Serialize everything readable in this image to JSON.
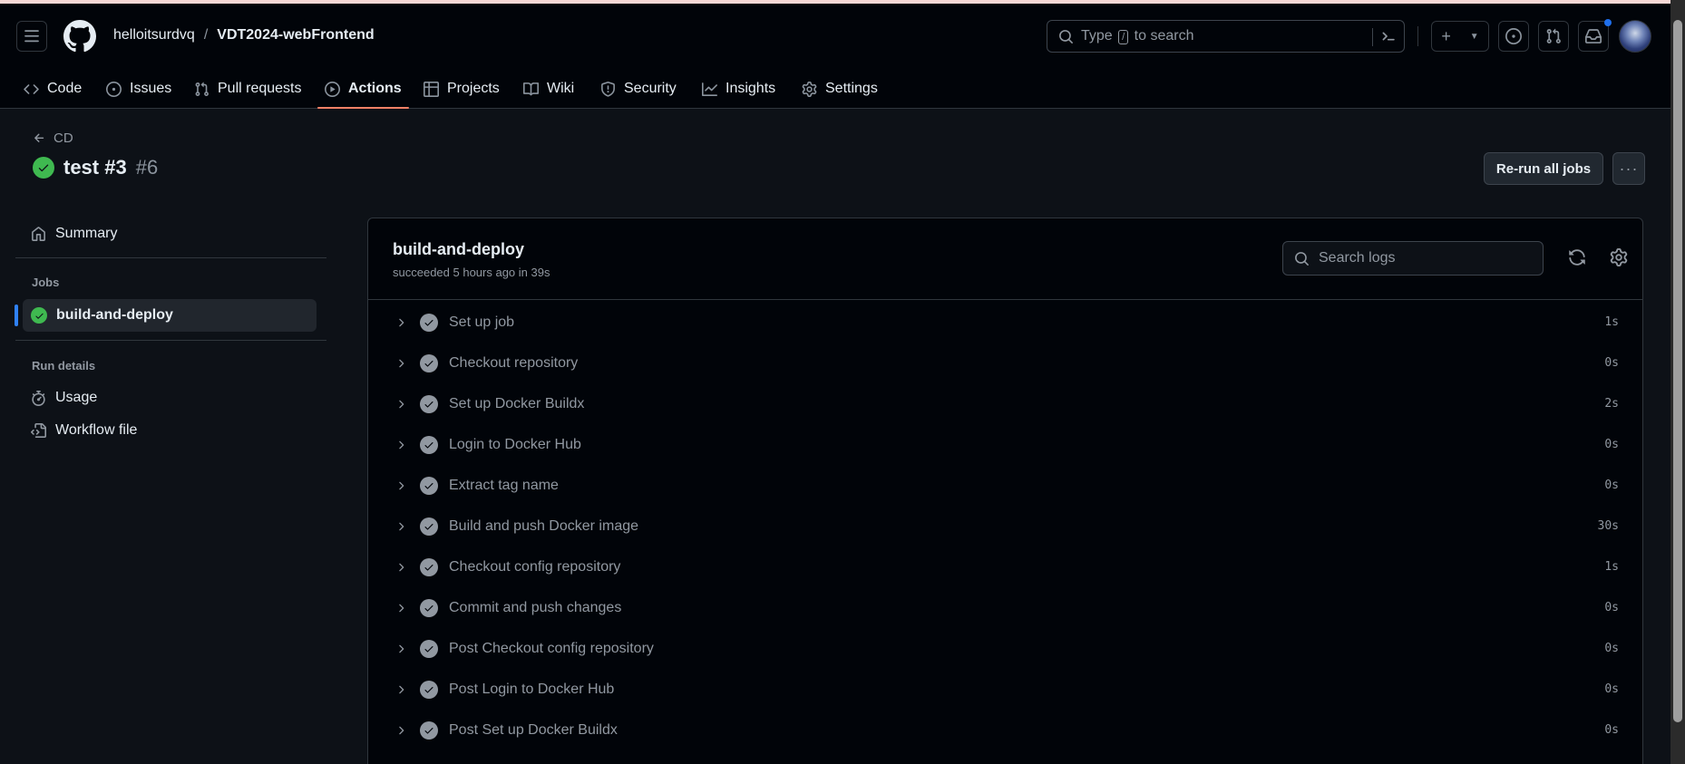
{
  "header": {
    "owner": "helloitsurdvq",
    "separator": "/",
    "repo": "VDT2024-webFrontend",
    "search_prefix": "Type",
    "search_key": "/",
    "search_suffix": "to search"
  },
  "nav": {
    "tabs": [
      {
        "label": "Code",
        "icon": "code-icon"
      },
      {
        "label": "Issues",
        "icon": "issue-icon"
      },
      {
        "label": "Pull requests",
        "icon": "pull-request-icon"
      },
      {
        "label": "Actions",
        "icon": "play-icon",
        "active": true
      },
      {
        "label": "Projects",
        "icon": "table-icon"
      },
      {
        "label": "Wiki",
        "icon": "book-icon"
      },
      {
        "label": "Security",
        "icon": "shield-icon"
      },
      {
        "label": "Insights",
        "icon": "graph-icon"
      },
      {
        "label": "Settings",
        "icon": "gear-icon"
      }
    ]
  },
  "run": {
    "back_label": "CD",
    "title": "test #3",
    "number": "#6",
    "rerun_label": "Re-run all jobs",
    "more_label": "···"
  },
  "sidebar": {
    "summary_label": "Summary",
    "jobs_heading": "Jobs",
    "job_label": "build-and-deploy",
    "run_details_heading": "Run details",
    "usage_label": "Usage",
    "workflow_file_label": "Workflow file"
  },
  "job": {
    "name": "build-and-deploy",
    "meta": "succeeded 5 hours ago in 39s",
    "search_placeholder": "Search logs"
  },
  "steps": [
    {
      "label": "Set up job",
      "duration": "1s"
    },
    {
      "label": "Checkout repository",
      "duration": "0s"
    },
    {
      "label": "Set up Docker Buildx",
      "duration": "2s"
    },
    {
      "label": "Login to Docker Hub",
      "duration": "0s"
    },
    {
      "label": "Extract tag name",
      "duration": "0s"
    },
    {
      "label": "Build and push Docker image",
      "duration": "30s"
    },
    {
      "label": "Checkout config repository",
      "duration": "1s"
    },
    {
      "label": "Commit and push changes",
      "duration": "0s"
    },
    {
      "label": "Post Checkout config repository",
      "duration": "0s"
    },
    {
      "label": "Post Login to Docker Hub",
      "duration": "0s"
    },
    {
      "label": "Post Set up Docker Buildx",
      "duration": "0s"
    }
  ],
  "colors": {
    "background": "#0d1117",
    "header_bg": "#010409",
    "success": "#3fb950",
    "active_tab_underline": "#f78166",
    "notification_dot": "#1f6feb"
  }
}
